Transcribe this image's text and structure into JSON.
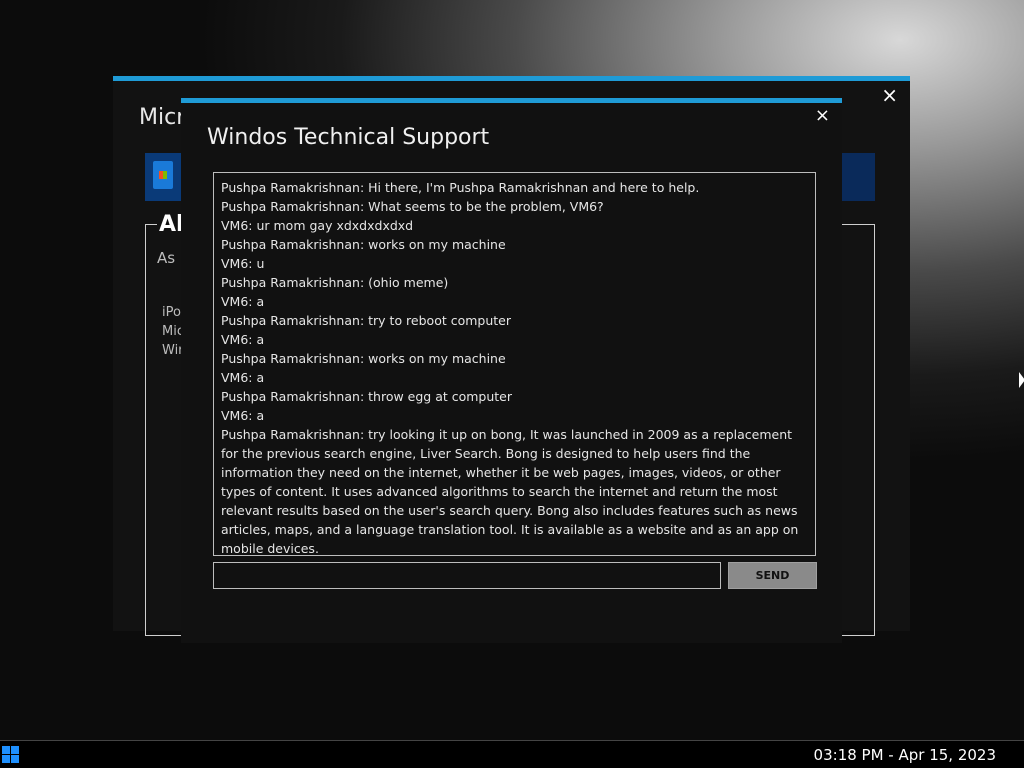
{
  "back_window": {
    "title": "Micr",
    "close_label": "×",
    "heading": "Al",
    "subheading": "As",
    "list_items": [
      "iPo",
      "Mic",
      "Wir"
    ]
  },
  "dialog": {
    "title": "Windos Technical Support",
    "close_label": "×",
    "messages": [
      "Pushpa Ramakrishnan: Hi there, I'm Pushpa Ramakrishnan and here to help.",
      "Pushpa Ramakrishnan: What seems to be the problem, VM6?",
      "VM6: ur mom gay xdxdxdxdxd",
      "Pushpa Ramakrishnan: works on my machine",
      "VM6: u",
      "Pushpa Ramakrishnan: (ohio meme)",
      "VM6: a",
      "Pushpa Ramakrishnan: try to reboot computer",
      "VM6: a",
      "Pushpa Ramakrishnan: works on my machine",
      "VM6: a",
      "Pushpa Ramakrishnan: throw egg at computer",
      "VM6: a",
      "Pushpa Ramakrishnan: try looking it up on bong, It was launched in 2009 as a replacement for the previous search engine, Liver Search. Bong is designed to help users find the information they need on the internet, whether it be web pages, images, videos, or other types of content. It uses advanced algorithms to search the internet and return the most relevant results based on the user's search query. Bong also includes features such as news articles, maps, and a language translation tool. It is available as a website and as an app on mobile devices."
    ],
    "input_value": "",
    "send_label": "SEND"
  },
  "taskbar": {
    "clock": "03:18 PM - Apr 15, 2023"
  },
  "colors": {
    "accent": "#1f9bd6",
    "start_icon": "#1e90ff"
  },
  "icons": {
    "start": "windows-logo-icon",
    "store": "store-bag-icon",
    "close": "close-icon"
  }
}
